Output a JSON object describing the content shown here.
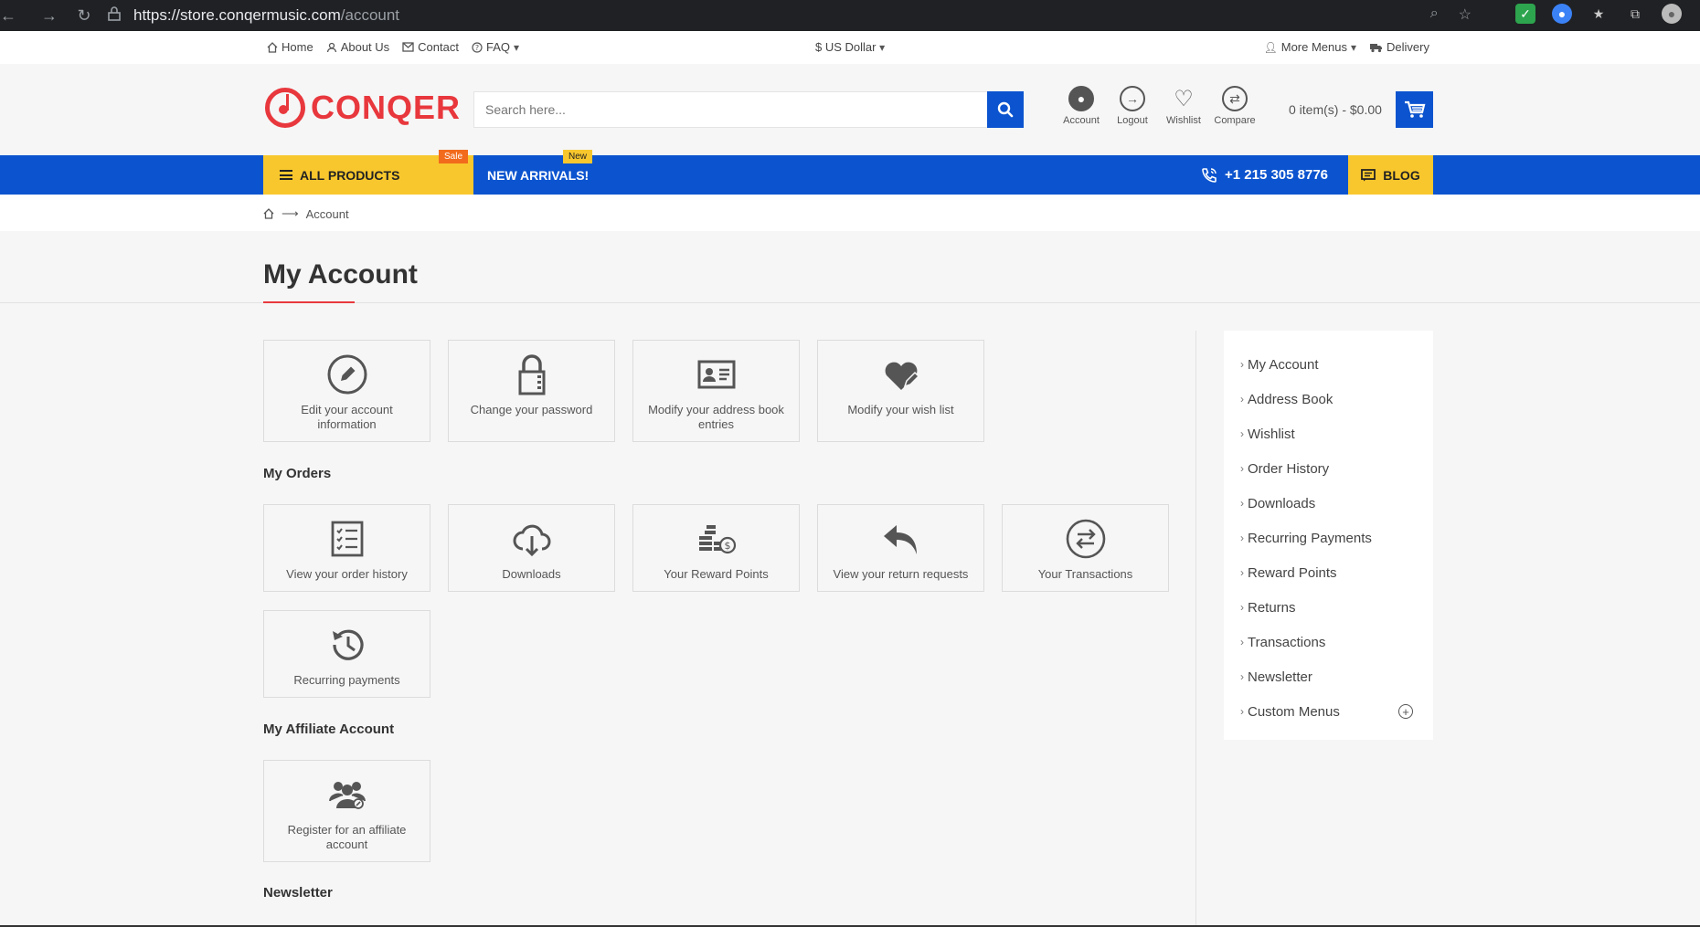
{
  "browser": {
    "url_host": "https://store.conqermusic.com",
    "url_path": "/account"
  },
  "topbar": {
    "home": "Home",
    "about": "About Us",
    "contact": "Contact",
    "faq": "FAQ",
    "currency": "$ US Dollar",
    "more_menus": "More Menus",
    "delivery": "Delivery"
  },
  "header": {
    "logo_text": "CONQER",
    "search_placeholder": "Search here...",
    "icons": {
      "account": "Account",
      "logout": "Logout",
      "wishlist": "Wishlist",
      "compare": "Compare"
    },
    "cart": "0 item(s) - $0.00"
  },
  "nav": {
    "all_products": "ALL PRODUCTS",
    "sale_badge": "Sale",
    "new_arrivals": "NEW ARRIVALS!",
    "new_badge": "New",
    "phone": "+1 215 305 8776",
    "blog": "BLOG"
  },
  "breadcrumb": {
    "current": "Account"
  },
  "page": {
    "title": "My Account",
    "account_tiles": [
      {
        "label": "Edit your account information",
        "icon": "pencil-icon"
      },
      {
        "label": "Change your password",
        "icon": "lock-icon"
      },
      {
        "label": "Modify your address book entries",
        "icon": "address-card-icon"
      },
      {
        "label": "Modify your wish list",
        "icon": "heart-edit-icon"
      }
    ],
    "orders_heading": "My Orders",
    "order_tiles": [
      {
        "label": "View your order history",
        "icon": "checklist-icon"
      },
      {
        "label": "Downloads",
        "icon": "cloud-download-icon"
      },
      {
        "label": "Your Reward Points",
        "icon": "coins-icon"
      },
      {
        "label": "View your return requests",
        "icon": "reply-icon"
      },
      {
        "label": "Your Transactions",
        "icon": "exchange-icon"
      },
      {
        "label": "Recurring payments",
        "icon": "history-icon"
      }
    ],
    "affiliate_heading": "My Affiliate Account",
    "affiliate_tiles": [
      {
        "label": "Register for an affiliate account",
        "icon": "users-icon"
      }
    ],
    "newsletter_heading": "Newsletter"
  },
  "sidebar": {
    "items": [
      {
        "label": "My Account"
      },
      {
        "label": "Address Book"
      },
      {
        "label": "Wishlist"
      },
      {
        "label": "Order History"
      },
      {
        "label": "Downloads"
      },
      {
        "label": "Recurring Payments"
      },
      {
        "label": "Reward Points"
      },
      {
        "label": "Returns"
      },
      {
        "label": "Transactions"
      },
      {
        "label": "Newsletter"
      },
      {
        "label": "Custom Menus"
      }
    ]
  },
  "colors": {
    "brand_red": "#e8383d",
    "brand_blue": "#0c54cf",
    "brand_yellow": "#f8c72d"
  }
}
